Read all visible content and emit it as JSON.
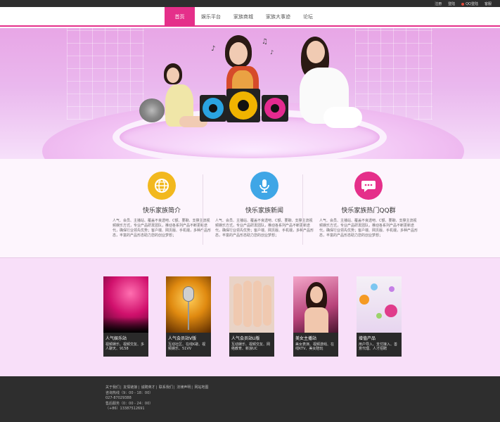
{
  "topbar": {
    "links": [
      "注册",
      "登陆",
      "QQ登陆",
      "客服"
    ]
  },
  "nav": {
    "items": [
      "首页",
      "娱乐平台",
      "家族商城",
      "家族大事迹",
      "论坛"
    ],
    "active_index": 0,
    "accent": "#e52f8a"
  },
  "features": [
    {
      "icon": "globe-icon",
      "color": "#f2b81e",
      "title": "快乐家族简介",
      "text": "人气、会员、主播站、覆盖不良透吧、C额、要聊、支撑主流视频娱乐方式，专业产品研发团队，推动各系列产品不断更新迭代，确保行业领先优势；客户端、网页版、手机端，多种产品形态，丰富的产品形态助力您的创业梦想；"
    },
    {
      "icon": "microphone-icon",
      "color": "#3fa6e6",
      "title": "快乐家族新闻",
      "text": "人气、会员、主播站、覆盖不良透吧、C额、要聊、支撑主流视频娱乐方式，专业产品研发团队，推动各系列产品不断更新迭代，确保行业领先优势；客户端、网页版、手机端，多种产品形态，丰富的产品形态助力您的创业梦想；"
    },
    {
      "icon": "chat-bubble-icon",
      "color": "#e52f8a",
      "title": "快乐家族热门QQ群",
      "text": "人气、会员、主播站、覆盖不良透吧、C额、要聊、支撑主流视频娱乐方式，专业产品研发团队，推动各系列产品不断更新迭代，确保行业领先优势；客户端、网页版、手机端，多种产品形态，丰富的产品形态助力您的创业梦想；"
    }
  ],
  "products": [
    {
      "title": "人气娱乐站",
      "desc": "视频娱乐、视频交友、多人聊天、9158"
    },
    {
      "title": "人气会员站V版",
      "desc": "互动社区、在线K歌、视频娱乐、51VV"
    },
    {
      "title": "人气会员站U版",
      "desc": "互动娱乐、视频交友、网络教育、新浪UC"
    },
    {
      "title": "美女主播站",
      "desc": "美女表演、视频游戏、在线KTV、美女陪玩"
    },
    {
      "title": "增值产品",
      "desc": "用户导入、支付接入、善意代理、人才招聘"
    }
  ],
  "footer": {
    "links": [
      "关于我们",
      "友情链接",
      "诚聘英才",
      "联系我们",
      "法律声明",
      "网站地图"
    ],
    "hours1": "咨询热线（9：00 - 18：00）",
    "phone1": "027-87029388",
    "hours2": "售后服务（0：00 - 24：00）",
    "phone2": "（+86）13387512691"
  }
}
